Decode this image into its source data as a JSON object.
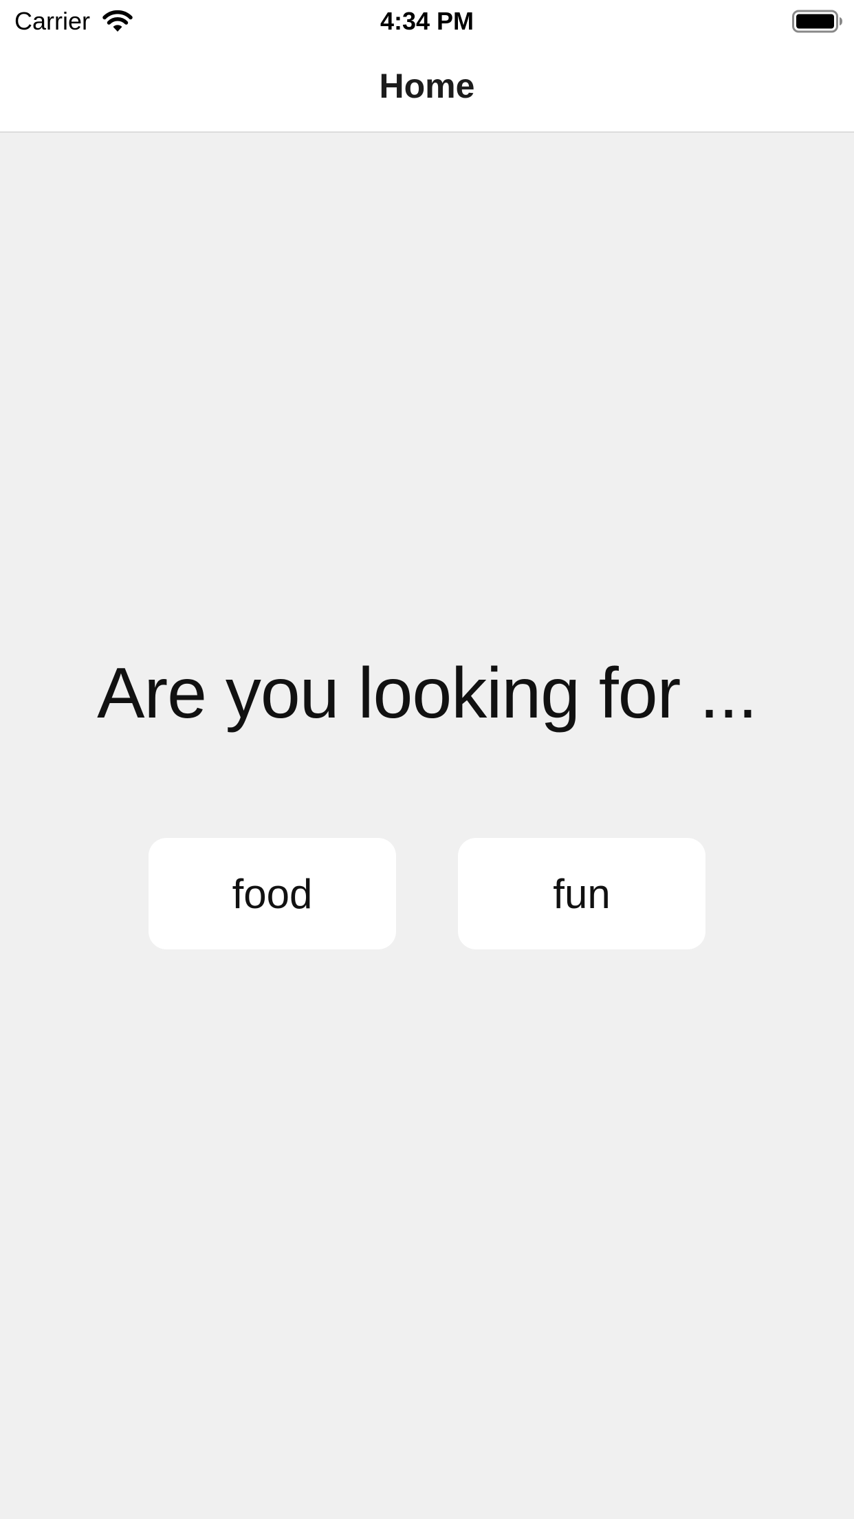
{
  "status_bar": {
    "carrier": "Carrier",
    "time": "4:34 PM",
    "wifi_icon": "wifi-icon",
    "battery_icon": "battery-icon"
  },
  "nav": {
    "title": "Home"
  },
  "main": {
    "prompt": "Are you looking for ...",
    "choices": [
      {
        "label": "food"
      },
      {
        "label": "fun"
      }
    ]
  },
  "colors": {
    "background": "#f0f0f0",
    "bar_background": "#ffffff",
    "button_background": "#ffffff",
    "text": "#000000"
  }
}
